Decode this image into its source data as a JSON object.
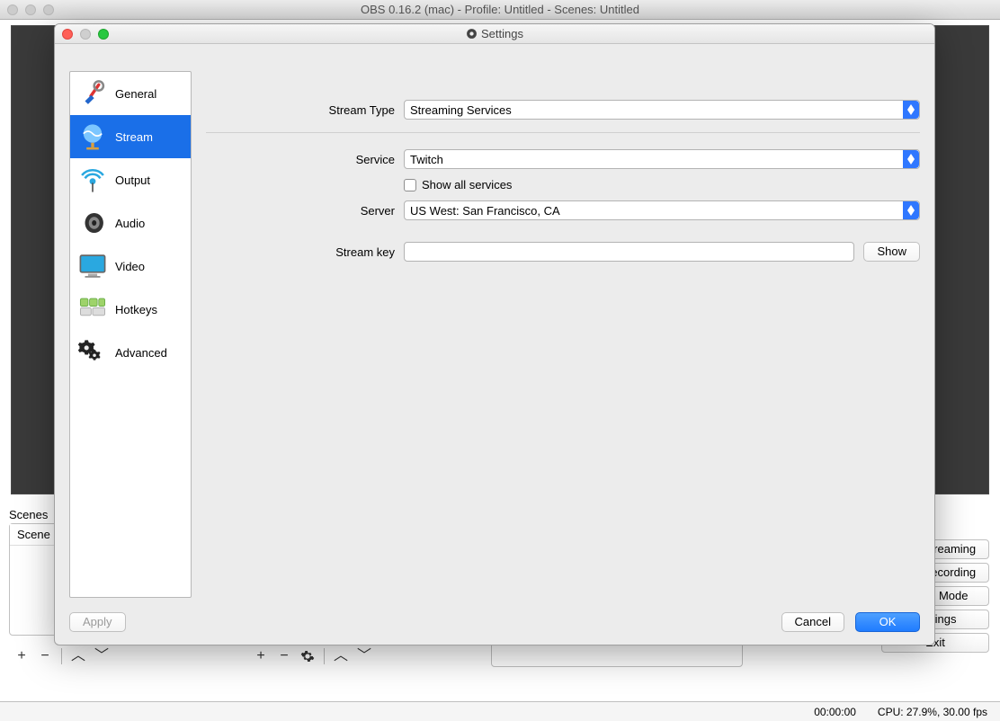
{
  "mainWindow": {
    "title": "OBS 0.16.2 (mac) - Profile: Untitled - Scenes: Untitled",
    "scenesLabel": "Scenes",
    "sceneItem": "Scene",
    "rightButtons": {
      "streaming": "Start Streaming",
      "recording": "Start Recording",
      "studio": "Studio Mode",
      "settings": "Settings",
      "exit": "Exit"
    },
    "status": {
      "time": "00:00:00",
      "cpu": "CPU: 27.9%, 30.00 fps"
    }
  },
  "settings": {
    "title": "Settings",
    "sidebar": [
      {
        "label": "General",
        "selected": false
      },
      {
        "label": "Stream",
        "selected": true
      },
      {
        "label": "Output",
        "selected": false
      },
      {
        "label": "Audio",
        "selected": false
      },
      {
        "label": "Video",
        "selected": false
      },
      {
        "label": "Hotkeys",
        "selected": false
      },
      {
        "label": "Advanced",
        "selected": false
      }
    ],
    "stream": {
      "streamTypeLabel": "Stream Type",
      "streamType": "Streaming Services",
      "serviceLabel": "Service",
      "service": "Twitch",
      "showAllLabel": "Show all services",
      "serverLabel": "Server",
      "server": "US West: San Francisco, CA",
      "streamKeyLabel": "Stream key",
      "streamKey": "",
      "showBtn": "Show"
    },
    "footer": {
      "apply": "Apply",
      "cancel": "Cancel",
      "ok": "OK"
    }
  }
}
